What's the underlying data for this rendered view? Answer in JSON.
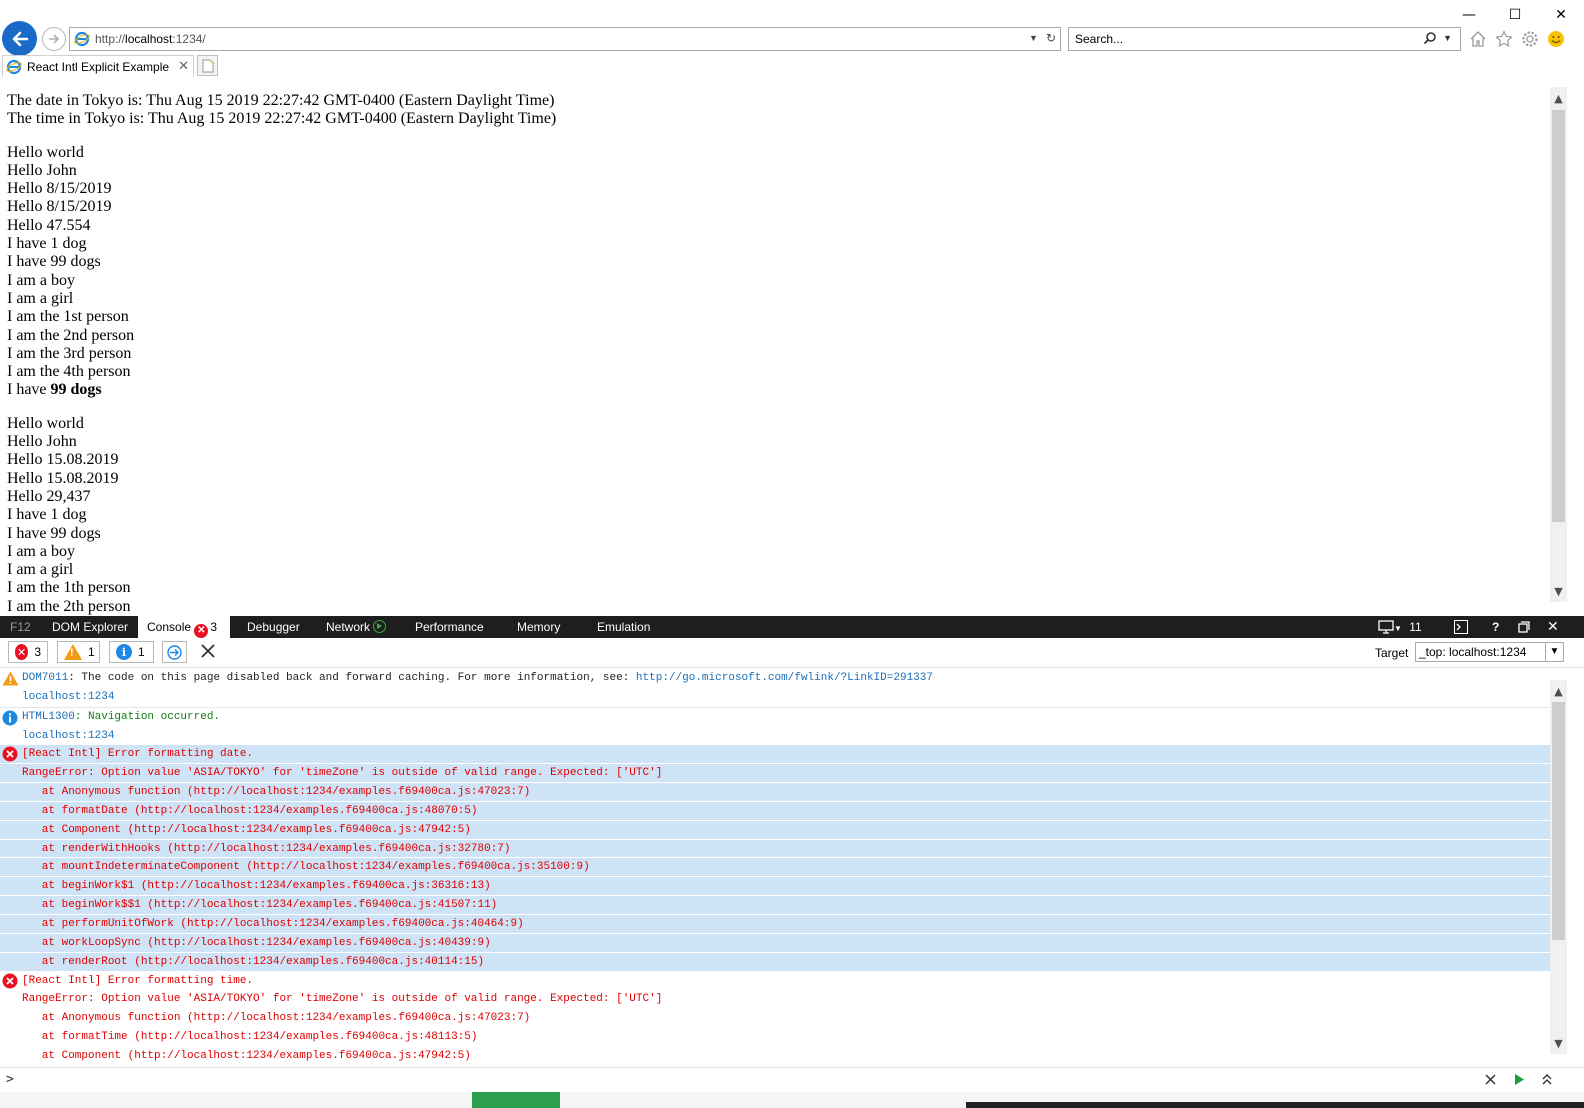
{
  "browser": {
    "url_prefix": "http://",
    "url_host": "localhost",
    "url_suffix": ":1234/",
    "search_placeholder": "Search...",
    "tab_title": "React Intl Explicit Example"
  },
  "page": {
    "tokyo_date": "The date in Tokyo is: Thu Aug 15 2019 22:27:42 GMT-0400 (Eastern Daylight Time)",
    "tokyo_time": "The time in Tokyo is: Thu Aug 15 2019 22:27:42 GMT-0400 (Eastern Daylight Time)",
    "block1": [
      "Hello world",
      "Hello John",
      "Hello 8/15/2019",
      "Hello 8/15/2019",
      "Hello 47.554",
      "I have 1 dog",
      "I have 99 dogs",
      "I am a boy",
      "I am a girl",
      "I am the 1st person",
      "I am the 2nd person",
      "I am the 3rd person",
      "I am the 4th person"
    ],
    "block1_last_prefix": "I have ",
    "block1_last_bold": "99 dogs",
    "block2": [
      "Hello world",
      "Hello John",
      "Hello 15.08.2019",
      "Hello 15.08.2019",
      "Hello 29,437",
      "I have 1 dog",
      "I have 99 dogs",
      "I am a boy",
      "I am a girl",
      "I am the 1th person",
      "I am the 2th person"
    ]
  },
  "devtools": {
    "f12": "F12",
    "tabs": [
      "DOM Explorer",
      "Console",
      "Debugger",
      "Network",
      "Performance",
      "Memory",
      "Emulation"
    ],
    "console_error_badge": "3",
    "console_count": "3",
    "mode_number": "11",
    "filters": {
      "errors": "3",
      "warnings": "1",
      "messages": "1"
    },
    "target_label": "Target",
    "target_value": "_top: localhost:1234",
    "messages": {
      "warn_code": "DOM7011",
      "warn_text": ": The code on this page disabled back and forward caching. For more information, see: ",
      "warn_link": "http://go.microsoft.com/fwlink/?LinkID=291337",
      "warn_src": "localhost:1234",
      "info_code": "HTML1300",
      "info_text": ": Navigation occurred.",
      "info_src": "localhost:1234",
      "err1": [
        "[React Intl] Error formatting date.",
        "RangeError: Option value 'ASIA/TOKYO' for 'timeZone' is outside of valid range. Expected: ['UTC']",
        "   at Anonymous function (http://localhost:1234/examples.f69400ca.js:47023:7)",
        "   at formatDate (http://localhost:1234/examples.f69400ca.js:48070:5)",
        "   at Component (http://localhost:1234/examples.f69400ca.js:47942:5)",
        "   at renderWithHooks (http://localhost:1234/examples.f69400ca.js:32780:7)",
        "   at mountIndeterminateComponent (http://localhost:1234/examples.f69400ca.js:35100:9)",
        "   at beginWork$1 (http://localhost:1234/examples.f69400ca.js:36316:13)",
        "   at beginWork$$1 (http://localhost:1234/examples.f69400ca.js:41507:11)",
        "   at performUnitOfWork (http://localhost:1234/examples.f69400ca.js:40464:9)",
        "   at workLoopSync (http://localhost:1234/examples.f69400ca.js:40439:9)",
        "   at renderRoot (http://localhost:1234/examples.f69400ca.js:40114:15)"
      ],
      "err2": [
        "[React Intl] Error formatting time.",
        "RangeError: Option value 'ASIA/TOKYO' for 'timeZone' is outside of valid range. Expected: ['UTC']",
        "   at Anonymous function (http://localhost:1234/examples.f69400ca.js:47023:7)",
        "   at formatTime (http://localhost:1234/examples.f69400ca.js:48113:5)",
        "   at Component (http://localhost:1234/examples.f69400ca.js:47942:5)"
      ]
    },
    "prompt": ">"
  },
  "colors": {
    "accent": "#1b6ac9",
    "error": "#e81123",
    "selected_row": "#cfe3f6",
    "devtools_bar": "#1e1e1e"
  }
}
